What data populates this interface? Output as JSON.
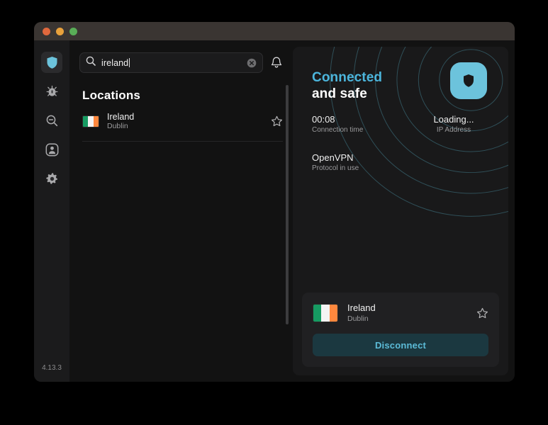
{
  "window": {
    "traffic_lights": [
      "close",
      "minimize",
      "zoom"
    ],
    "version": "4.13.3"
  },
  "sidebar": {
    "items": [
      {
        "name": "vpn",
        "icon": "shield-icon",
        "active": true
      },
      {
        "name": "tracker-blocker",
        "icon": "bug-icon",
        "active": false
      },
      {
        "name": "search-privacy",
        "icon": "magnifier-minus-icon",
        "active": false
      },
      {
        "name": "account",
        "icon": "person-icon",
        "active": false
      },
      {
        "name": "settings",
        "icon": "gear-icon",
        "active": false
      }
    ]
  },
  "search": {
    "value": "ireland",
    "placeholder": "Search",
    "icon": "search-icon",
    "clear_icon": "clear-circle-icon",
    "bell_icon": "bell-icon"
  },
  "locations": {
    "heading": "Locations",
    "rows": [
      {
        "country": "Ireland",
        "city": "Dublin",
        "flag": "ireland-flag",
        "favorite": false
      }
    ]
  },
  "connection": {
    "status_line1": "Connected",
    "status_line2": "and safe",
    "time_value": "00:08",
    "time_label": "Connection time",
    "protocol_value": "OpenVPN",
    "protocol_label": "Protocol in use",
    "ip_value": "Loading...",
    "ip_label": "IP Address",
    "badge_icon": "shield-badge-icon"
  },
  "current_location_card": {
    "country": "Ireland",
    "city": "Dublin",
    "flag": "ireland-flag",
    "favorite": false,
    "disconnect_label": "Disconnect"
  },
  "colors": {
    "accent": "#4cb6dd",
    "badge": "#6cc3dc",
    "disconnect_bg": "#1b3840",
    "disconnect_text": "#5cbcd8",
    "panel_bg": "#19191a",
    "window_bg": "#121212",
    "sidebar_bg": "#1b1b1c",
    "titlebar_bg": "#3a3532",
    "flag_green": "#169b62",
    "flag_orange": "#ff883e"
  }
}
